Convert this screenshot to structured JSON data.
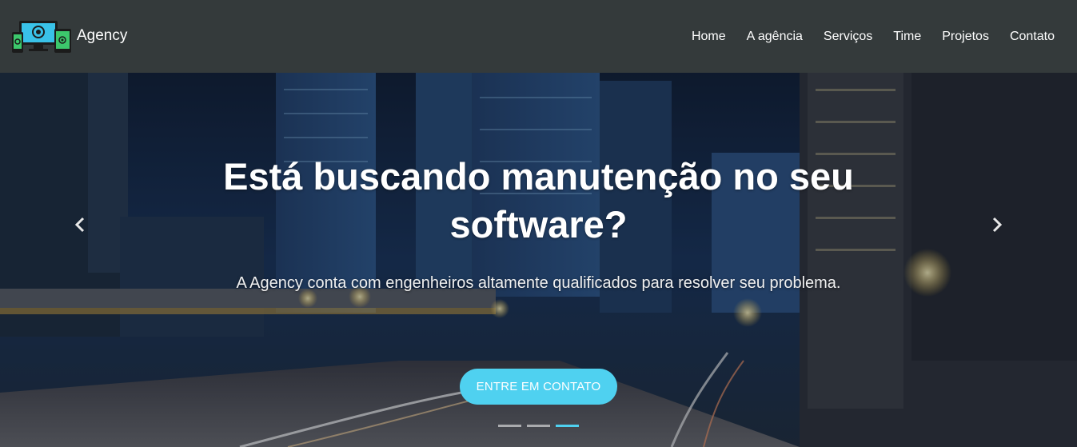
{
  "brand": {
    "name": "Agency"
  },
  "nav": {
    "items": [
      {
        "label": "Home"
      },
      {
        "label": "A agência"
      },
      {
        "label": "Serviços"
      },
      {
        "label": "Time"
      },
      {
        "label": "Projetos"
      },
      {
        "label": "Contato"
      }
    ]
  },
  "hero": {
    "title": "Está buscando manutenção no seu software?",
    "subtitle": "A Agency conta com engenheiros altamente qualificados para resolver seu problema.",
    "cta_label": "ENTRE EM CONTATO",
    "active_slide": 3,
    "slide_count": 3
  },
  "colors": {
    "navbar_bg": "#343a3b",
    "accent": "#4fd1f0",
    "text": "#ffffff"
  },
  "icons": {
    "prev": "chevron-left-icon",
    "next": "chevron-right-icon",
    "logo": "devices-logo-icon"
  }
}
